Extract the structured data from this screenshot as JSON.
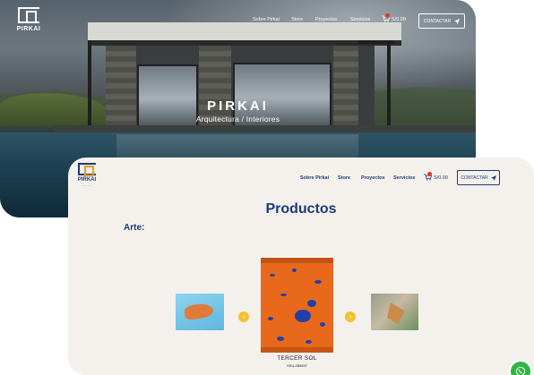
{
  "hero": {
    "logo_text": "PIRKAI",
    "nav": [
      "Sobre Pirkai",
      "Store",
      "Proyectos",
      "Servicios"
    ],
    "cart_total": "S/0.00",
    "cta_label": "CONTACTAR",
    "title": "PIRKAI",
    "subtitle": "Arquitectura / Interiores"
  },
  "products_page": {
    "logo_text": "PIRKAI",
    "nav": [
      "Sobre Pirkai",
      "Store",
      "Proyectos",
      "Servicios"
    ],
    "cart_total": "S/0.00",
    "cta_label": "CONTACTAR",
    "title": "Productos",
    "section_label": "Arte:",
    "carousel": {
      "featured_name": "TERCER SOL",
      "featured_sku": "SKU-289897",
      "prev_icon": "chevron-left-icon",
      "next_icon": "chevron-right-icon"
    }
  },
  "icons": {
    "cart": "cart-icon",
    "send": "paper-plane-icon",
    "whatsapp": "whatsapp-icon"
  },
  "colors": {
    "brand_blue": "#1d3a78",
    "accent_yellow": "#f2c12e",
    "cart_badge": "#e2342a",
    "whatsapp_green": "#2cb742"
  }
}
